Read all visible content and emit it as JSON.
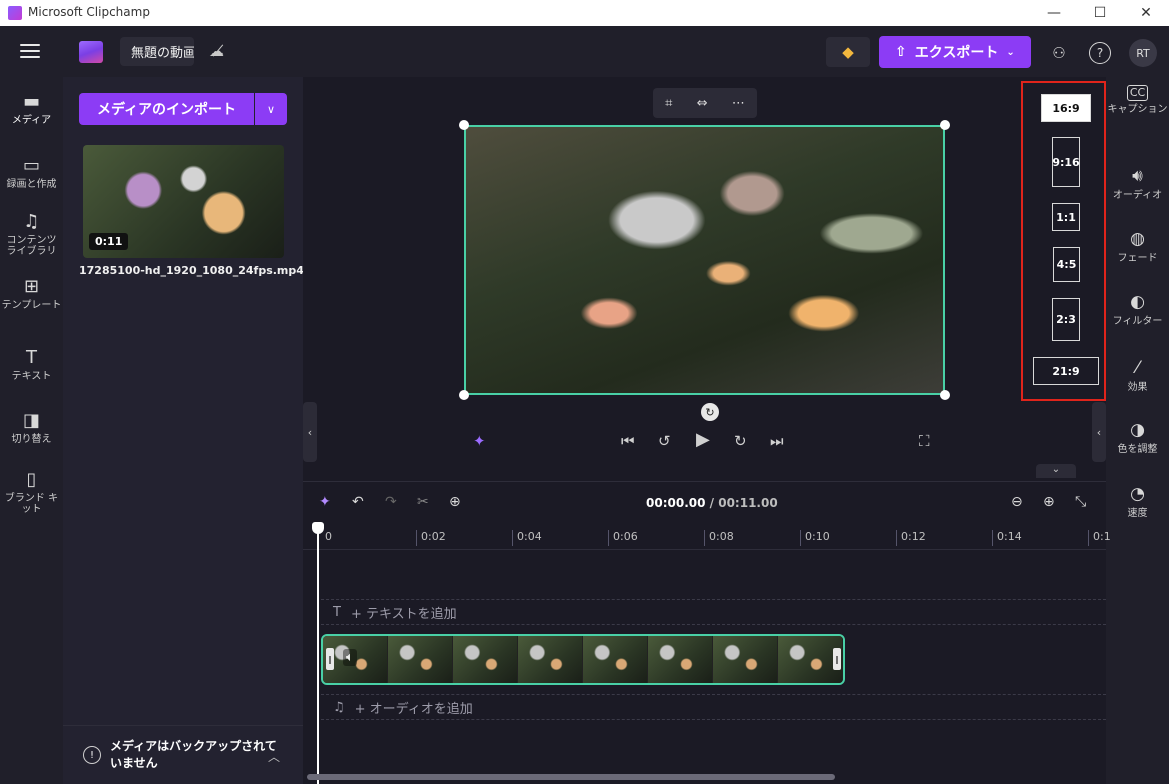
{
  "window": {
    "title": "Microsoft Clipchamp",
    "minimize": "—",
    "maximize": "☐",
    "close": "✕"
  },
  "header": {
    "project_name": "無題の動画",
    "export_label": "エクスポート",
    "avatar_initials": "RT"
  },
  "left_rail": {
    "items": [
      {
        "label": "メディア",
        "icon": "folder-icon"
      },
      {
        "label": "録画と作成",
        "icon": "camera-icon"
      },
      {
        "label": "コンテンツ ライブラリ",
        "icon": "content-library-icon"
      },
      {
        "label": "テンプレート",
        "icon": "templates-icon"
      },
      {
        "label": "テキスト",
        "icon": "text-icon"
      },
      {
        "label": "切り替え",
        "icon": "transitions-icon"
      },
      {
        "label": "ブランド キット",
        "icon": "brand-kit-icon"
      }
    ]
  },
  "media": {
    "import_label": "メディアのインポート",
    "clip_duration": "0:11",
    "clip_filename": "17285100-hd_1920_1080_24fps.mp4",
    "backup_notice": "メディアはバックアップされていません"
  },
  "aspect_ratios": {
    "options": [
      "16:9",
      "9:16",
      "1:1",
      "4:5",
      "2:3",
      "21:9"
    ],
    "selected": "16:9"
  },
  "right_rail": {
    "items": [
      {
        "label": "キャプション",
        "icon": "cc-icon"
      },
      {
        "label": "オーディオ",
        "icon": "speaker-icon"
      },
      {
        "label": "フェード",
        "icon": "fade-icon"
      },
      {
        "label": "フィルター",
        "icon": "filter-icon"
      },
      {
        "label": "効果",
        "icon": "effects-wand-icon"
      },
      {
        "label": "色を調整",
        "icon": "color-adjust-icon"
      },
      {
        "label": "速度",
        "icon": "speed-icon"
      }
    ]
  },
  "timeline": {
    "current_time": "00:00.00",
    "total_time": "/ 00:11.00",
    "ruler_ticks": [
      "0",
      "0:02",
      "0:04",
      "0:06",
      "0:08",
      "0:10",
      "0:12",
      "0:14",
      "0:1"
    ],
    "add_text_label": "+ テキストを追加",
    "add_audio_label": "+ オーディオを追加"
  },
  "colors": {
    "accent": "#8c3cf5",
    "selection": "#49d0a6",
    "highlight_box": "#e0241b"
  }
}
